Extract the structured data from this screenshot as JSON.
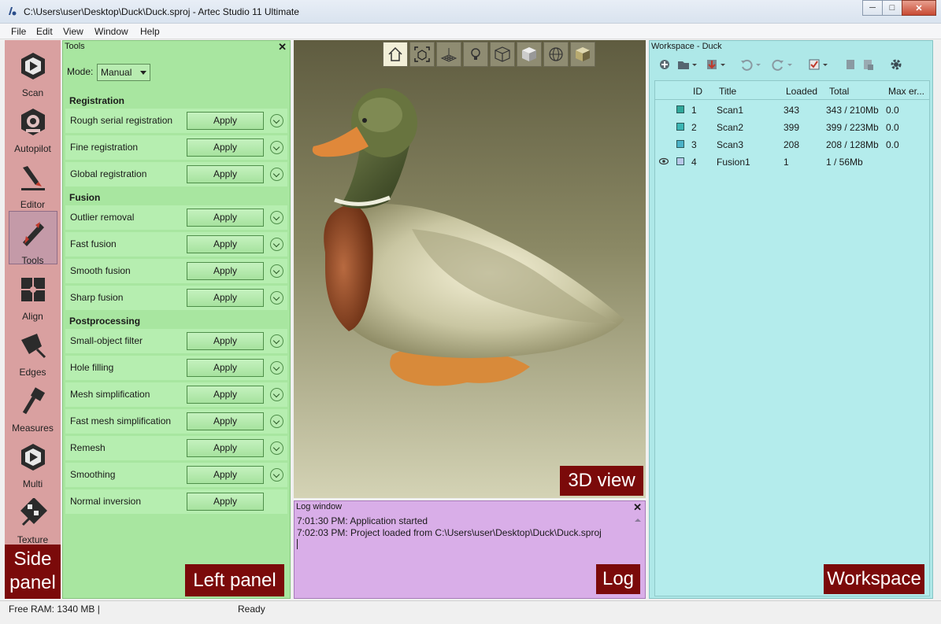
{
  "window": {
    "title": "C:\\Users\\user\\Desktop\\Duck\\Duck.sproj - Artec Studio 11 Ultimate",
    "minimize": "─",
    "maximize": "□",
    "close": "✕"
  },
  "menu": [
    "File",
    "Edit",
    "View",
    "Window",
    "Help"
  ],
  "side_panel": {
    "items": [
      {
        "label": "Scan",
        "icon": "scan-icon"
      },
      {
        "label": "Autopilot",
        "icon": "autopilot-icon"
      },
      {
        "label": "Editor",
        "icon": "editor-icon"
      },
      {
        "label": "Tools",
        "icon": "tools-icon",
        "active": true
      },
      {
        "label": "Align",
        "icon": "align-icon"
      },
      {
        "label": "Edges",
        "icon": "edges-icon"
      },
      {
        "label": "Measures",
        "icon": "measures-icon"
      },
      {
        "label": "Multi",
        "icon": "multi-icon"
      },
      {
        "label": "Texture",
        "icon": "texture-icon"
      }
    ],
    "caption_line1": "Side",
    "caption_line2": "panel"
  },
  "tools_panel": {
    "header": "Tools",
    "close": "✕",
    "mode_label": "Mode:",
    "mode_value": "Manual",
    "sections": {
      "registration": "Registration",
      "fusion": "Fusion",
      "postprocessing": "Postprocessing"
    },
    "apply_label": "Apply",
    "tools": [
      "Rough serial registration",
      "Fine registration",
      "Global registration",
      "Outlier removal",
      "Fast fusion",
      "Smooth fusion",
      "Sharp fusion",
      "Small-object filter",
      "Hole filling",
      "Mesh simplification",
      "Fast mesh simplification",
      "Remesh",
      "Smoothing",
      "Normal inversion"
    ],
    "caption": "Left panel"
  },
  "view3d": {
    "toolbar_icons": [
      "home-icon",
      "fit-view-icon",
      "grid-icon",
      "light-icon",
      "wireframe-cube-icon",
      "solid-cube-icon",
      "sphere-icon",
      "textured-cube-icon"
    ],
    "caption": "3D view",
    "colors": {
      "bg_top": "#5f5c40",
      "bg_bottom": "#d4d3b5"
    }
  },
  "log": {
    "header": "Log window",
    "close": "✕",
    "lines": [
      "7:01:30 PM: Application started",
      "7:02:03 PM: Project loaded from C:\\Users\\user\\Desktop\\Duck\\Duck.sproj"
    ],
    "caption": "Log"
  },
  "workspace": {
    "header": "Workspace - Duck",
    "columns": [
      "ID",
      "Title",
      "Loaded",
      "Total",
      "Max er..."
    ],
    "rows": [
      {
        "id": "1",
        "title": "Scan1",
        "loaded": "343",
        "total": "343 / 210Mb",
        "max_err": "0.0",
        "color": "#2fa89a"
      },
      {
        "id": "2",
        "title": "Scan2",
        "loaded": "399",
        "total": "399 / 223Mb",
        "max_err": "0.0",
        "color": "#3ab6b4"
      },
      {
        "id": "3",
        "title": "Scan3",
        "loaded": "208",
        "total": "208 / 128Mb",
        "max_err": "0.0",
        "color": "#4bb2c8"
      },
      {
        "id": "4",
        "title": "Fusion1",
        "loaded": "1",
        "total": "1 / 56Mb",
        "max_err": "",
        "color": "#b8c8e8",
        "visible": true
      }
    ],
    "caption": "Workspace"
  },
  "status": {
    "ram": "Free RAM: 1340 MB  |",
    "state": "Ready"
  },
  "colors": {
    "side_panel": "#d9a0a0",
    "left_panel": "#a8e6a0",
    "log_panel": "#d9aee8",
    "workspace": "#aee8e8",
    "caption_bg": "#7b0a0a"
  }
}
